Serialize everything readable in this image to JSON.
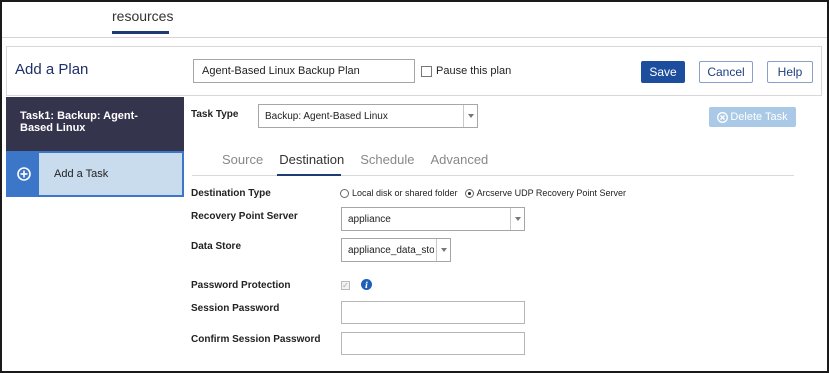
{
  "nav": {
    "active_tab": "resources"
  },
  "plan": {
    "heading": "Add a Plan",
    "name_value": "Agent-Based Linux Backup Plan",
    "pause_label": "Pause this plan",
    "save_label": "Save",
    "cancel_label": "Cancel",
    "help_label": "Help"
  },
  "sidebar": {
    "task_label": "Task1: Backup: Agent-Based Linux",
    "add_task_label": "Add a Task"
  },
  "task": {
    "type_label": "Task Type",
    "type_value": "Backup: Agent-Based Linux",
    "delete_label": "Delete Task"
  },
  "tabs": [
    "Source",
    "Destination",
    "Schedule",
    "Advanced"
  ],
  "active_tab": "Destination",
  "destination": {
    "type_label": "Destination Type",
    "option_local": "Local disk or shared folder",
    "option_rps": "Arcserve UDP Recovery Point Server",
    "selected_option": "Arcserve UDP Recovery Point Server",
    "rps_label": "Recovery Point Server",
    "rps_value": "appliance",
    "datastore_label": "Data Store",
    "datastore_value": "appliance_data_store",
    "password_protection_label": "Password Protection",
    "password_protection_checked": true,
    "session_password_label": "Session Password",
    "confirm_password_label": "Confirm Session Password"
  },
  "colors": {
    "primary": "#1d4e9e",
    "sidebar_dark": "#35344d",
    "add_task_bg": "#c9dcee",
    "delete_disabled": "#a9c9e6"
  }
}
